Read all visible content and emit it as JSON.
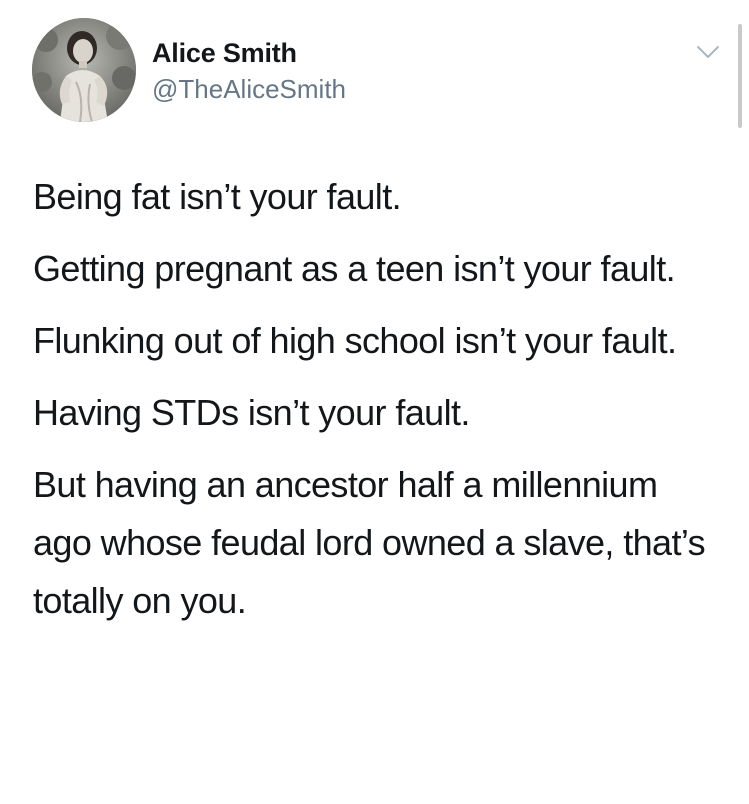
{
  "author": {
    "display_name": "Alice Smith",
    "handle": "@TheAliceSmith",
    "avatar": "vintage-girl-portrait"
  },
  "menu": {
    "icon": "chevron-down-icon"
  },
  "colors": {
    "text": "#14171a",
    "handle": "#657786",
    "caret": "#aab8c2"
  },
  "tweet": {
    "paragraphs": [
      "Being fat isn’t your fault.",
      "Getting pregnant as a teen isn’t your fault.",
      "Flunking out of high school isn’t your fault.",
      "Having STDs isn’t your fault.",
      "But having an ancestor half a millennium ago whose feudal lord owned a slave, that’s totally on you."
    ]
  }
}
